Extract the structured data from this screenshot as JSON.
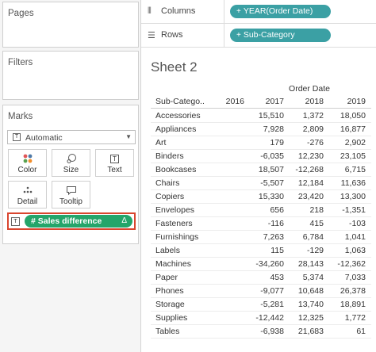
{
  "left_panel": {
    "pages_title": "Pages",
    "filters_title": "Filters",
    "marks_title": "Marks",
    "mark_type": "Automatic",
    "mark_type_icon": "T",
    "buttons": {
      "color": "Color",
      "size": "Size",
      "text": "Text",
      "detail": "Detail",
      "tooltip": "Tooltip"
    },
    "text_icon_glyph": "T",
    "text_mark_icon": "T",
    "sales_pill": "# Sales difference",
    "sales_pill_delta": "Δ"
  },
  "shelves": {
    "columns_label": "Columns",
    "columns_pill": "YEAR(Order Date)",
    "rows_label": "Rows",
    "rows_pill": "Sub-Category",
    "plus_glyph": "+"
  },
  "sheet": {
    "title": "Sheet 2",
    "column_header_title": "Order Date",
    "headers": {
      "subcategory": "Sub-Catego..",
      "y2016": "2016",
      "y2017": "2017",
      "y2018": "2018",
      "y2019": "2019"
    },
    "rows": [
      {
        "name": "Accessories",
        "y2017": "15,510",
        "y2018": "1,372",
        "y2019": "18,050"
      },
      {
        "name": "Appliances",
        "y2017": "7,928",
        "y2018": "2,809",
        "y2019": "16,877"
      },
      {
        "name": "Art",
        "y2017": "179",
        "y2018": "-276",
        "y2019": "2,902"
      },
      {
        "name": "Binders",
        "y2017": "-6,035",
        "y2018": "12,230",
        "y2019": "23,105"
      },
      {
        "name": "Bookcases",
        "y2017": "18,507",
        "y2018": "-12,268",
        "y2019": "6,715"
      },
      {
        "name": "Chairs",
        "y2017": "-5,507",
        "y2018": "12,184",
        "y2019": "11,636"
      },
      {
        "name": "Copiers",
        "y2017": "15,330",
        "y2018": "23,420",
        "y2019": "13,300"
      },
      {
        "name": "Envelopes",
        "y2017": "656",
        "y2018": "218",
        "y2019": "-1,351"
      },
      {
        "name": "Fasteners",
        "y2017": "-116",
        "y2018": "415",
        "y2019": "-103"
      },
      {
        "name": "Furnishings",
        "y2017": "7,263",
        "y2018": "6,784",
        "y2019": "1,041"
      },
      {
        "name": "Labels",
        "y2017": "115",
        "y2018": "-129",
        "y2019": "1,063"
      },
      {
        "name": "Machines",
        "y2017": "-34,260",
        "y2018": "28,143",
        "y2019": "-12,362"
      },
      {
        "name": "Paper",
        "y2017": "453",
        "y2018": "5,374",
        "y2019": "7,033"
      },
      {
        "name": "Phones",
        "y2017": "-9,077",
        "y2018": "10,648",
        "y2019": "26,378"
      },
      {
        "name": "Storage",
        "y2017": "-5,281",
        "y2018": "13,740",
        "y2019": "18,891"
      },
      {
        "name": "Supplies",
        "y2017": "-12,442",
        "y2018": "12,325",
        "y2019": "1,772"
      },
      {
        "name": "Tables",
        "y2017": "-6,938",
        "y2018": "21,683",
        "y2019": "61"
      }
    ]
  },
  "colors": {
    "pill_dimension": "#3ba0a4",
    "pill_measure": "#24a56a",
    "highlight_border": "#d9452f"
  }
}
